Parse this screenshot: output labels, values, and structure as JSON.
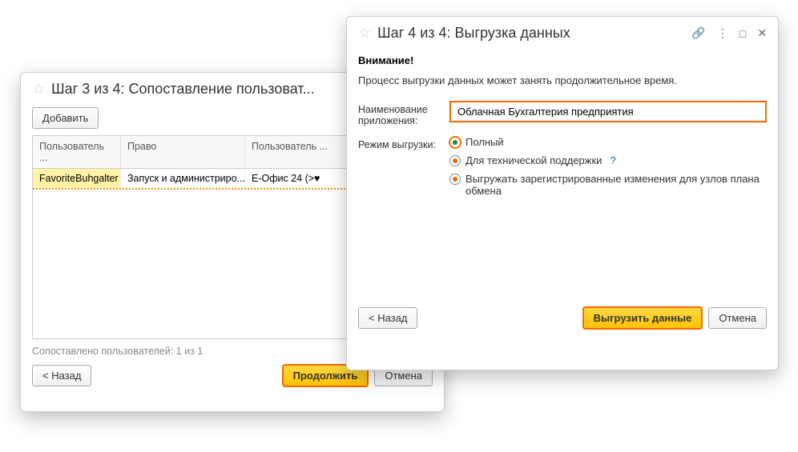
{
  "step3": {
    "title": "Шаг 3 из 4: Сопоставление пользоват...",
    "add_btn": "Добавить",
    "columns": {
      "c1": "Пользователь ...",
      "c2": "Право",
      "c3": "Пользователь ..."
    },
    "row": {
      "user": "FavoriteBuhgalter",
      "right": "Запуск и администриро...",
      "appuser": "Е-Офис 24 (>♥"
    },
    "status": "Сопоставлено пользователей: 1 из 1",
    "back": "< Назад",
    "continue": "Продолжить",
    "cancel": "Отмена"
  },
  "step4": {
    "title": "Шаг 4 из 4: Выгрузка данных",
    "warn_title": "Внимание!",
    "warn_text": "Процесс выгрузки данных может занять продолжительное время.",
    "name_label": "Наименование приложения:",
    "name_value": "Облачная Бухгалтерия предприятия",
    "mode_label": "Режим выгрузки:",
    "mode_full": "Полный",
    "mode_tech": "Для технической поддержки",
    "mode_tech_help": "?",
    "mode_nodes": "Выгружать зарегистрированные изменения для узлов плана обмена",
    "back": "< Назад",
    "export": "Выгрузить данные",
    "cancel": "Отмена"
  }
}
